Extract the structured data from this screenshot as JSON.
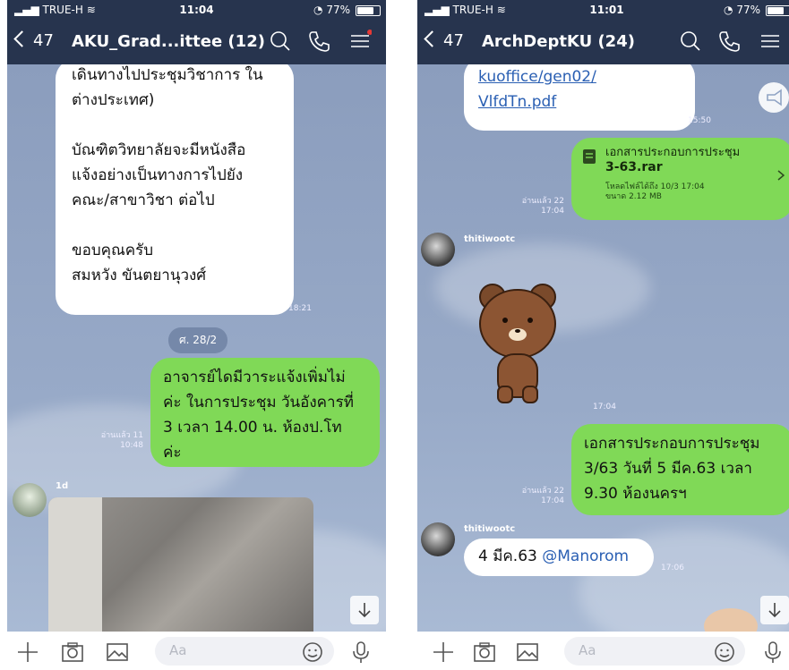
{
  "left": {
    "status": {
      "carrier": "TRUE-H",
      "time": "11:04",
      "battery": "77%",
      "battery_level": 0.77
    },
    "header": {
      "back_count": "47",
      "title": "AKU_Grad...ittee (12)"
    },
    "messages": {
      "first_text": [
        "เดินทางไปประชุมวิชาการ ใน",
        "ต่างประเทศ)",
        "",
        "บัณฑิตวิทยาลัยจะมีหนังสือ",
        "แจ้งอย่างเป็นทางการไปยัง",
        "คณะ/สาขาวิชา ต่อไป",
        "",
        "ขอบคุณครับ",
        "สมหวัง ขันตยานุวงศ์"
      ],
      "first_time": "18:21",
      "date_pill": "ศ. 28/2",
      "second_text": [
        "อาจารย์ไดมีวาระแจ้งเพิ่มไม่",
        "ค่ะ ในการประชุม วันอังคารที่",
        "3 เวลา 14.00 น. ห้องป.โท",
        "ค่ะ"
      ],
      "second_read": "อ่านแล้ว 11",
      "second_time": "10:48",
      "sender": "1d"
    },
    "composer": {
      "placeholder": "Aa"
    }
  },
  "right": {
    "status": {
      "carrier": "TRUE-H",
      "time": "11:01",
      "battery": "77%",
      "battery_level": 0.77
    },
    "header": {
      "back_count": "47",
      "title": "ArchDeptKU (24)"
    },
    "messages": {
      "link_lines": [
        "kuoffice/gen02/",
        "VlfdTn.pdf"
      ],
      "link_time": "15:50",
      "file_title": [
        "เอกสารประกอบการประชุม",
        "3-63.rar"
      ],
      "file_download": "โหลดไฟล์ได้ถึง 10/3 17:04",
      "file_size": "ขนาด 2.12 MB",
      "file_read": "อ่านแล้ว 22",
      "file_time": "17:04",
      "sender1": "thitiwootc",
      "sticker_time": "17:04",
      "text_lines": [
        "เอกสารประกอบการประชุม",
        "3/63 วันที่ 5 มีค.63 เวลา",
        "9.30 ห้องนครฯ"
      ],
      "text_read": "อ่านแล้ว 22",
      "text_time": "17:04",
      "sender2": "thitiwootc",
      "last_prefix": "4 มีค.63 ",
      "last_mention": "@Manorom",
      "last_time": "17:06"
    },
    "composer": {
      "placeholder": "Aa"
    }
  },
  "icons": {
    "search": "search-icon",
    "call": "phone-icon",
    "menu": "menu-icon",
    "plus": "plus-icon",
    "camera": "camera-icon",
    "image": "image-icon",
    "emoji": "emoji-icon",
    "mic": "mic-icon",
    "down": "arrow-down-icon",
    "file": "file-icon",
    "announce": "megaphone-icon"
  },
  "colors": {
    "header": "#27344e",
    "green_bubble": "#80d957",
    "chat_bg": "#8b9dbd",
    "notify_dot": "#e53935"
  }
}
